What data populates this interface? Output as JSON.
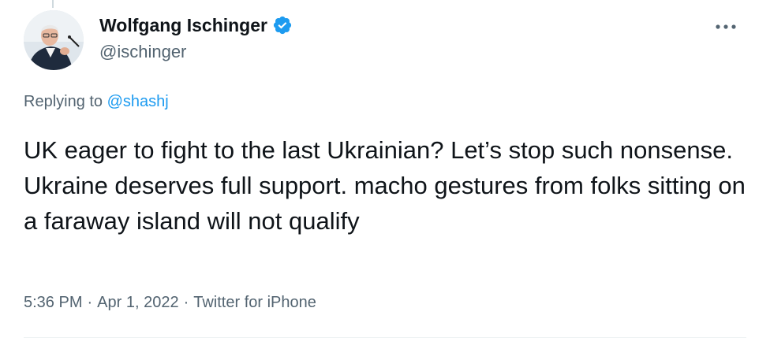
{
  "author": {
    "display_name": "Wolfgang Ischinger",
    "handle": "@ischinger",
    "verified": true,
    "verified_color": "#1d9bf0"
  },
  "reply_context": {
    "prefix": "Replying to",
    "mention": "@shashj"
  },
  "tweet": {
    "text": "UK eager to fight to the last Ukrainian? Let’s stop such nonsense. Ukraine deserves full support. macho gestures from folks sitting on a faraway island will not qualify"
  },
  "meta": {
    "time": "5:36 PM",
    "separator": "·",
    "date": "Apr 1, 2022",
    "source": "Twitter for iPhone"
  },
  "icons": {
    "more": "more-horizontal-icon",
    "verified": "verified-badge-icon"
  },
  "colors": {
    "accent": "#1d9bf0",
    "text_primary": "#0f1419",
    "text_secondary": "#536471"
  }
}
